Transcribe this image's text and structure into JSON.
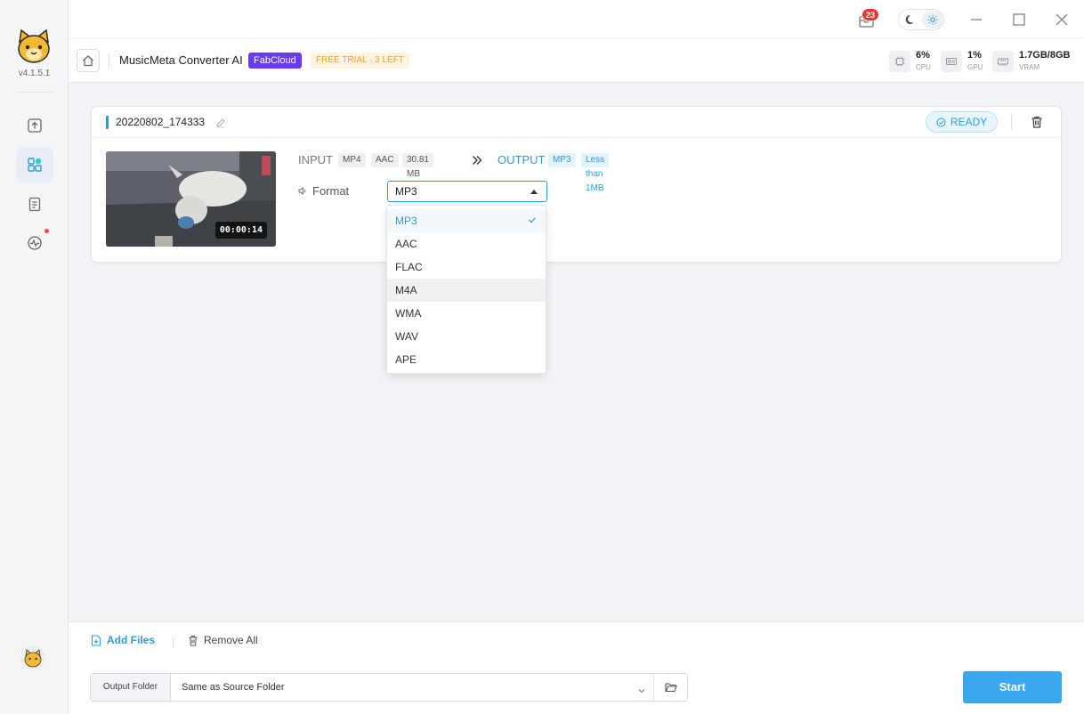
{
  "app": {
    "version": "v4.1.5.1",
    "title": "MusicMeta Converter AI",
    "cloud_badge": "FabCloud",
    "trial_badge": "FREE TRIAL · 3 LEFT"
  },
  "titlebar": {
    "notification_count": "23"
  },
  "stats": {
    "cpu_value": "6%",
    "cpu_label": "CPU",
    "gpu_value": "1%",
    "gpu_label": "GPU",
    "vram_value": "1.7GB/8GB",
    "vram_label": "VRAM"
  },
  "task": {
    "file_name": "20220802_174333",
    "status": "READY",
    "duration": "00:00:14",
    "input_label": "INPUT",
    "input_chips": [
      "MP4",
      "AAC",
      "30.81 MB"
    ],
    "output_label": "OUTPUT",
    "output_chips": [
      "MP3",
      "Less than 1MB"
    ],
    "format_label": "Format",
    "format_selected": "MP3"
  },
  "format_options": [
    "MP3",
    "AAC",
    "FLAC",
    "M4A",
    "WMA",
    "WAV",
    "APE"
  ],
  "bottom": {
    "add_files": "Add Files",
    "remove_all": "Remove All",
    "output_folder_label": "Output Folder",
    "output_folder_value": "Same as Source Folder",
    "start": "Start"
  },
  "colors": {
    "accent": "#2d9cdb",
    "start_button": "#3aa8f0",
    "cloud_badge": "#6a3cf0",
    "trial_text": "#f0a020",
    "notification_badge": "#e53935"
  }
}
